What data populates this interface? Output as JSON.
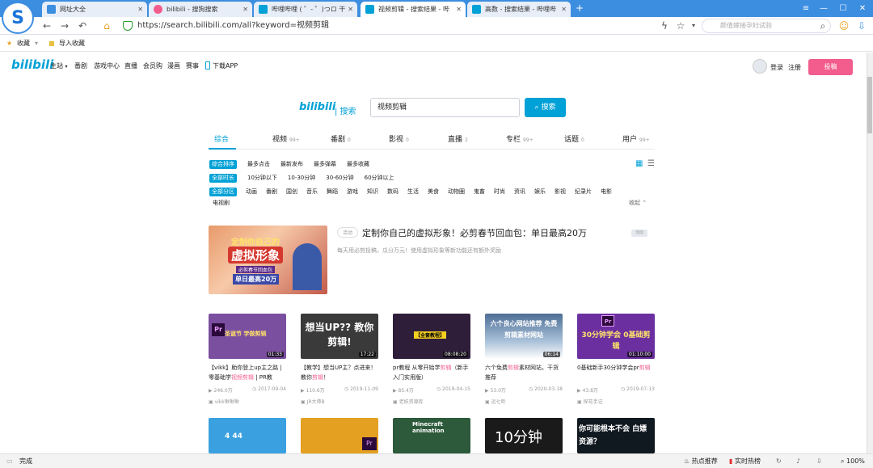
{
  "browser": {
    "tabs": [
      {
        "title": "网址大全",
        "color": "#3c8ee0",
        "active": false
      },
      {
        "title": "bilibili - 搜狗搜索",
        "color": "#f25d8e",
        "active": false
      },
      {
        "title": "哔哩哔哩 ( ゜- ゜)つロ 干",
        "color": "#00a1d6",
        "active": false
      },
      {
        "title": "视频剪辑 - 搜索结果 - 哔",
        "color": "#00a1d6",
        "active": true
      },
      {
        "title": "高数 - 搜索结果 - 哔哩哔",
        "color": "#00a1d6",
        "active": false
      }
    ],
    "url": "https://search.bilibili.com/all?keyword=视频剪辑",
    "side_search_placeholder": "颜值嫁接孕妇试验",
    "favorites": [
      "收藏",
      "导入收藏"
    ],
    "status_left": "完成",
    "status_right": [
      "热点推荐",
      "实时热榜",
      "100%"
    ],
    "logo_glyph": "S"
  },
  "header": {
    "logo": "bilibili",
    "nav": [
      "主站",
      "番剧",
      "游戏中心",
      "直播",
      "会员购",
      "漫画",
      "赛事",
      "下载APP"
    ],
    "login": "登录",
    "register": "注册",
    "upload": "投稿"
  },
  "search": {
    "logo": "bilibili",
    "logo_suffix": "| 搜索",
    "query": "视频剪辑",
    "button": "搜索"
  },
  "tabs": [
    {
      "label": "综合",
      "count": ""
    },
    {
      "label": "视频",
      "count": "99+"
    },
    {
      "label": "番剧",
      "count": "0"
    },
    {
      "label": "影视",
      "count": "0"
    },
    {
      "label": "直播",
      "count": "2"
    },
    {
      "label": "专栏",
      "count": "99+"
    },
    {
      "label": "话题",
      "count": "0"
    },
    {
      "label": "用户",
      "count": "99+"
    }
  ],
  "filters": {
    "order": [
      "综合排序",
      "最多点击",
      "最新发布",
      "最多弹幕",
      "最多收藏"
    ],
    "duration": [
      "全部时长",
      "10分钟以下",
      "10-30分钟",
      "30-60分钟",
      "60分钟以上"
    ],
    "zone": [
      "全部分区",
      "动画",
      "番剧",
      "国创",
      "音乐",
      "舞蹈",
      "游戏",
      "知识",
      "数码",
      "生活",
      "美食",
      "动物圈",
      "鬼畜",
      "时尚",
      "资讯",
      "娱乐",
      "影视",
      "纪录片",
      "电影"
    ],
    "zone_more": "电视剧",
    "collapse": "收起"
  },
  "feature": {
    "badge": "活动",
    "title": "定制你自己的虚拟形象！必剪春节回血包：单日最高20万",
    "desc": "每天用必剪投稿，瓜分万元！使用虚拟形象等新功能还有额外奖励",
    "tag": "活动",
    "banner_title": "定制你自己的",
    "banner_big": "虚拟形象",
    "banner_sub": "必剪春节回血包",
    "banner_amount": "单日最高20万"
  },
  "videos": [
    {
      "thumb_text": "圣诞节 学做剪辑",
      "thumb_bg": "#7b4fa0",
      "dur": "01:33",
      "title_pre": "【vikk】助你登上up主之路 | 零基础学",
      "title_em": "视频剪辑",
      "title_post": " | PR教",
      "plays": "246.0万",
      "date": "2017-09-04",
      "up": "vikk啾啾啾"
    },
    {
      "thumb_text": "想当UP?? 教你剪辑!",
      "thumb_bg": "#3a3a3a",
      "dur": "17:22",
      "title_pre": "【教学】想当UP主？点进来！教你",
      "title_em": "剪辑",
      "title_post": "！",
      "plays": "110.6万",
      "date": "2019-11-09",
      "up": "JR大帅B"
    },
    {
      "thumb_text": "【全套教程】",
      "thumb_bg": "#2f1e3a",
      "dur": "08:08:20",
      "title_pre": "pr教程 从零开始学",
      "title_em": "剪辑",
      "title_post": "（新手入门实用版）",
      "plays": "85.4万",
      "date": "2019-04-15",
      "up": "老妖资源库"
    },
    {
      "thumb_text": "六个良心网站推荐 免费剪辑素材网站",
      "thumb_bg": "#4d6e96",
      "dur": "06:14",
      "title_pre": "六个免费",
      "title_em": "剪辑",
      "title_post": "素材网站，干货推荐",
      "plays": "53.0万",
      "date": "2020-03-18",
      "up": "远七听"
    },
    {
      "thumb_text": "30分钟学会 0基础剪辑",
      "thumb_bg": "#6b2fa0",
      "dur": "01:10:00",
      "title_pre": "0基础新手30分钟学会pr",
      "title_em": "剪辑",
      "title_post": "",
      "plays": "43.8万",
      "date": "2019-07-13",
      "up": "探花手记"
    }
  ],
  "videos_row2": [
    {
      "thumb_text": "4 44",
      "thumb_bg": "#3ba0e0"
    },
    {
      "thumb_text": "Pr",
      "thumb_bg": "#e4a020"
    },
    {
      "thumb_text": "Minecraft animation",
      "thumb_bg": "#2c5a3a"
    },
    {
      "thumb_text": "10分钟",
      "thumb_bg": "#1a1a1a"
    },
    {
      "thumb_text": "你可能根本不会 白嫖资源？",
      "thumb_bg": "#101820"
    }
  ],
  "colors": {
    "accent": "#00a1d6",
    "pink": "#f25d8e"
  }
}
